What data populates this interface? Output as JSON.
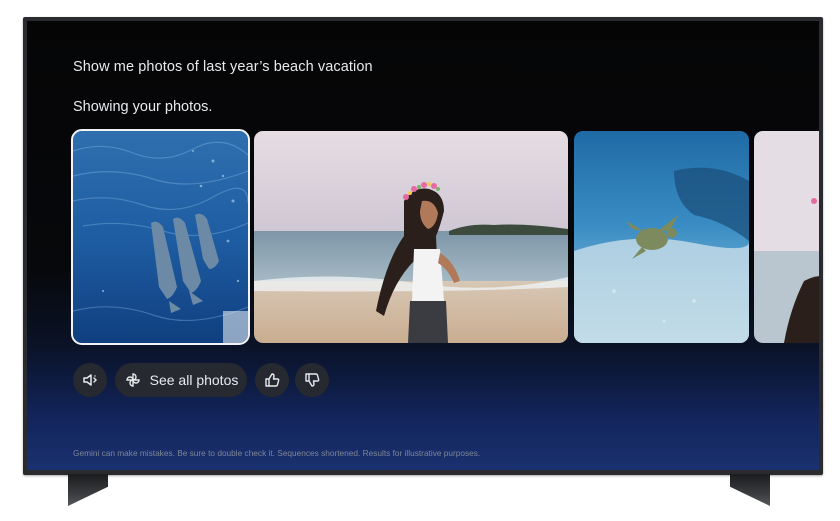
{
  "assistant": {
    "query": "Show me photos of last year’s beach vacation",
    "response": "Showing your photos."
  },
  "photos": [
    {
      "icon": "dolphins-photo",
      "subject": "dolphins"
    },
    {
      "icon": "beach-portrait-photo",
      "subject": "woman on beach"
    },
    {
      "icon": "sea-turtle-photo",
      "subject": "sea turtle"
    },
    {
      "icon": "partial-photo",
      "subject": "beach"
    }
  ],
  "controls": {
    "speaker_icon": "speaker-icon",
    "see_all_label": "See all photos",
    "see_all_icon": "photos-pinwheel-icon",
    "thumbs_up_icon": "thumbs-up-icon",
    "thumbs_down_icon": "thumbs-down-icon"
  },
  "disclaimer": "Gemini can make mistakes. Be sure to double check it. Sequences shortened. Results for illustrative purposes.",
  "colors": {
    "text": "#e8eaed",
    "chip": "#26292f",
    "gradient_bottom": "#1a3170"
  }
}
